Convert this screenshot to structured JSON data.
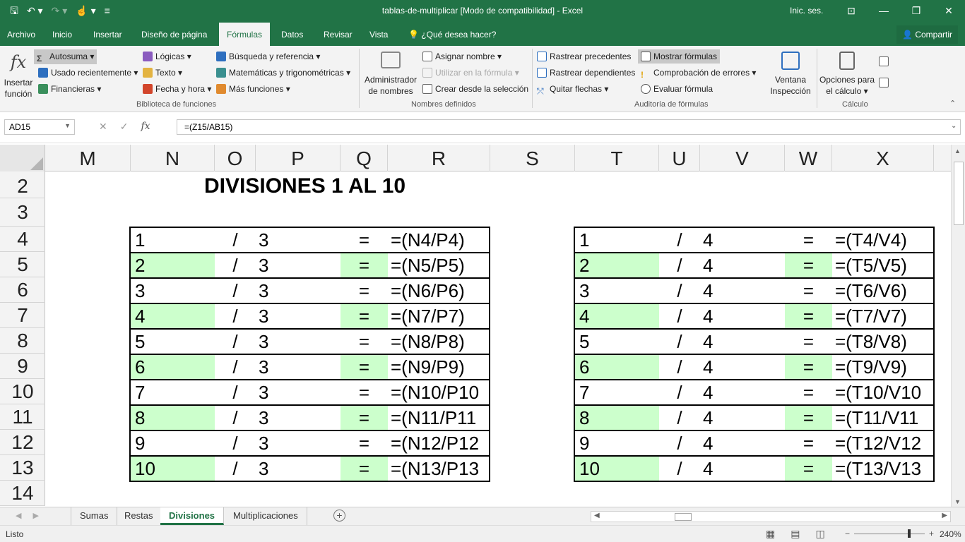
{
  "window": {
    "title": "tablas-de-multiplicar  [Modo de compatibilidad]  -  Excel",
    "signin": "Inic. ses."
  },
  "ribbon_tabs": [
    "Archivo",
    "Inicio",
    "Insertar",
    "Diseño de página",
    "Fórmulas",
    "Datos",
    "Revisar",
    "Vista",
    "¿Qué desea hacer?"
  ],
  "share_label": "Compartir",
  "ribbon": {
    "insert_function": "Insertar función",
    "biblioteca": {
      "label": "Biblioteca de funciones",
      "autosuma": "Autosuma",
      "usado": "Usado recientemente",
      "financieras": "Financieras",
      "logicas": "Lógicas",
      "texto": "Texto",
      "fecha": "Fecha y hora",
      "busqueda": "Búsqueda y referencia",
      "matematicas": "Matemáticas y trigonométricas",
      "mas": "Más funciones"
    },
    "nombres": {
      "label": "Nombres definidos",
      "administrador": "Administrador de nombres",
      "asignar": "Asignar nombre",
      "utilizar": "Utilizar en la fórmula",
      "crear": "Crear desde la selección"
    },
    "auditoria": {
      "label": "Auditoría de fórmulas",
      "precedentes": "Rastrear precedentes",
      "dependientes": "Rastrear dependientes",
      "quitar": "Quitar flechas",
      "mostrar": "Mostrar fórmulas",
      "comprobacion": "Comprobación de errores",
      "evaluar": "Evaluar fórmula",
      "ventana": "Ventana Inspección"
    },
    "calculo": {
      "label": "Cálculo",
      "opciones": "Opciones para el cálculo"
    }
  },
  "formula_bar": {
    "name_box": "AD15",
    "formula": "=(Z15/AB15)"
  },
  "columns": [
    "M",
    "N",
    "O",
    "P",
    "Q",
    "R",
    "S",
    "T",
    "U",
    "V",
    "W",
    "X"
  ],
  "rows": [
    "2",
    "3",
    "4",
    "5",
    "6",
    "7",
    "8",
    "9",
    "10",
    "11",
    "12",
    "13",
    "14"
  ],
  "sheet_title": "DIVISIONES 1 AL 10",
  "tables": [
    {
      "divisor": "3",
      "rows": [
        {
          "n": "1",
          "f": "=(N4/P4)"
        },
        {
          "n": "2",
          "f": "=(N5/P5)"
        },
        {
          "n": "3",
          "f": "=(N6/P6)"
        },
        {
          "n": "4",
          "f": "=(N7/P7)"
        },
        {
          "n": "5",
          "f": "=(N8/P8)"
        },
        {
          "n": "6",
          "f": "=(N9/P9)"
        },
        {
          "n": "7",
          "f": "=(N10/P10"
        },
        {
          "n": "8",
          "f": "=(N11/P11"
        },
        {
          "n": "9",
          "f": "=(N12/P12"
        },
        {
          "n": "10",
          "f": "=(N13/P13"
        }
      ]
    },
    {
      "divisor": "4",
      "rows": [
        {
          "n": "1",
          "f": "=(T4/V4)"
        },
        {
          "n": "2",
          "f": "=(T5/V5)"
        },
        {
          "n": "3",
          "f": "=(T6/V6)"
        },
        {
          "n": "4",
          "f": "=(T7/V7)"
        },
        {
          "n": "5",
          "f": "=(T8/V8)"
        },
        {
          "n": "6",
          "f": "=(T9/V9)"
        },
        {
          "n": "7",
          "f": "=(T10/V10"
        },
        {
          "n": "8",
          "f": "=(T11/V11"
        },
        {
          "n": "9",
          "f": "=(T12/V12"
        },
        {
          "n": "10",
          "f": "=(T13/V13"
        }
      ]
    }
  ],
  "symbols": {
    "slash": "/",
    "equals": "="
  },
  "sheet_tabs": [
    "Sumas",
    "Restas",
    "Divisiones",
    "Multiplicaciones"
  ],
  "active_sheet": "Divisiones",
  "status": {
    "ready": "Listo",
    "zoom": "240%"
  },
  "colors": {
    "accent": "#217346",
    "green_cell": "#ccffcc"
  }
}
